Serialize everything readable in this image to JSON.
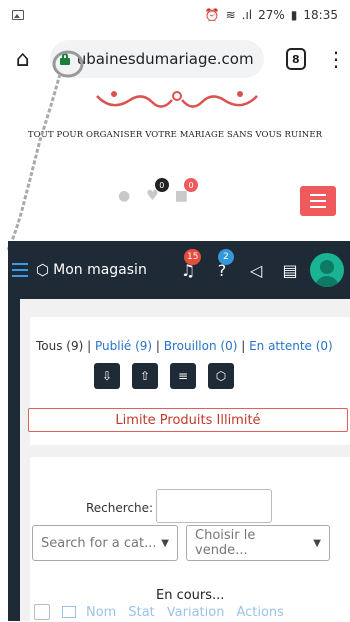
{
  "status_bar": {
    "battery": "27%",
    "time": "18:35",
    "signal_text": ".ıl"
  },
  "browser": {
    "url": "ubainesdumariage.com",
    "tab_count": "8",
    "menu_glyph": "⋮",
    "home_glyph": "⌂"
  },
  "site": {
    "tagline": "TOUT POUR ORGANISER VOTRE MARIAGE SANS VOUS RUINER",
    "wishlist_count": "0",
    "cart_count": "0",
    "accent_color": "#ef5a5c"
  },
  "dashboard": {
    "store_label": "Mon magasin",
    "notifications_count": "15",
    "help_count": "2",
    "nav_color": "#1e2a36"
  },
  "products": {
    "filter_all": "Tous (9)",
    "filter_published": "Publié (9)",
    "filter_draft": "Brouillon (0)",
    "filter_pending": "En attente (0)",
    "sep": " | ",
    "limit_text": "Limite Produits Illimité",
    "search_label": "Recherche:",
    "search_value": "",
    "category_placeholder": "Search for a cat...",
    "vendor_placeholder": "Choisir le vende...",
    "columns": [
      "Nom",
      "Stat",
      "Variation",
      "Actions"
    ],
    "loading_text": "En cours..."
  }
}
